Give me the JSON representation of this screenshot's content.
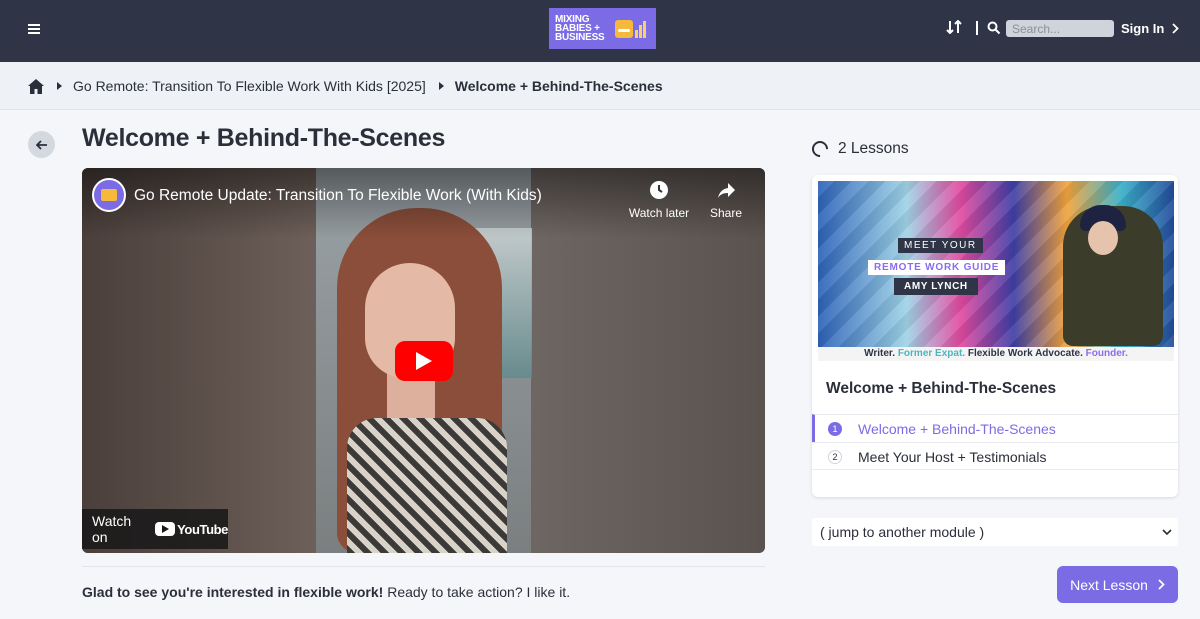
{
  "header": {
    "logo_text": "MIXING BABIES + BUSINESS",
    "search_placeholder": "Search...",
    "sign_in_label": "Sign In",
    "background_color": "#2f3547",
    "accent_color": "#7b6ce6"
  },
  "breadcrumb": {
    "items": [
      {
        "label": "Go Remote: Transition To Flexible Work With Kids [2025]"
      },
      {
        "label": "Welcome + Behind-The-Scenes"
      }
    ]
  },
  "main": {
    "title": "Welcome + Behind-The-Scenes",
    "video": {
      "title": "Go Remote Update: Transition To Flexible Work (With Kids)",
      "watch_later_label": "Watch later",
      "share_label": "Share",
      "watch_on_label": "Watch on",
      "youtube_label": "YouTube"
    },
    "intro_bold": "Glad to see you're interested in flexible work!",
    "intro_rest": " Ready to take action? I like it."
  },
  "sidebar": {
    "lessons_count": "2 Lessons",
    "thumbnail": {
      "tag1": "MEET YOUR",
      "tag2": "REMOTE WORK GUIDE",
      "tag3": "AMY LYNCH",
      "caption_a": "Writer. ",
      "caption_b": "Former Expat. ",
      "caption_c": "Flexible Work Advocate. ",
      "caption_d": "Founder."
    },
    "card_title": "Welcome + Behind-The-Scenes",
    "lessons": [
      {
        "number": "1",
        "label": "Welcome + Behind-The-Scenes",
        "active": true
      },
      {
        "number": "2",
        "label": "Meet Your Host + Testimonials",
        "active": false
      }
    ],
    "module_select_value": "( jump to another module )",
    "next_lesson_label": "Next Lesson"
  }
}
